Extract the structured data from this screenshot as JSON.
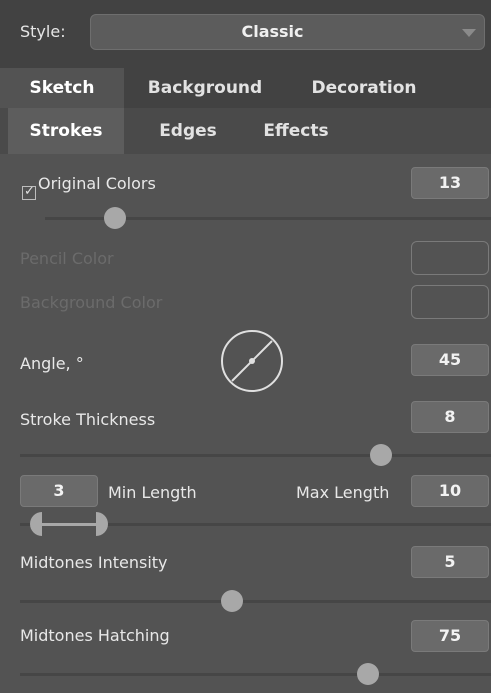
{
  "style": {
    "label": "Style:",
    "selected": "Classic"
  },
  "main_tabs": [
    {
      "label": "Sketch",
      "active": true
    },
    {
      "label": "Background",
      "active": false
    },
    {
      "label": "Decoration",
      "active": false
    }
  ],
  "sub_tabs": [
    {
      "label": "Strokes",
      "active": true
    },
    {
      "label": "Edges",
      "active": false
    },
    {
      "label": "Effects",
      "active": false
    }
  ],
  "original_colors": {
    "label": "Original Colors",
    "checked": true,
    "value": "13",
    "slider_fraction": 0.21
  },
  "pencil_color": {
    "label": "Pencil Color",
    "enabled": false
  },
  "background_color": {
    "label": "Background Color",
    "enabled": false
  },
  "angle": {
    "label": "Angle, °",
    "value": "45"
  },
  "stroke_thickness": {
    "label": "Stroke Thickness",
    "value": "8",
    "slider_fraction": 0.8
  },
  "length": {
    "min_value": "3",
    "min_label": "Min Length",
    "max_label": "Max Length",
    "max_value": "10"
  },
  "midtones_intensity": {
    "label": "Midtones Intensity",
    "value": "5",
    "slider_fraction": 0.45
  },
  "midtones_hatching": {
    "label": "Midtones Hatching",
    "value": "75",
    "slider_fraction": 0.75
  },
  "colors": {
    "panel": "#535353",
    "header": "#424242",
    "handle": "#a8a8a8"
  },
  "icons": {
    "dropdown": "chevron-down-icon",
    "angle": "angle-dial-icon",
    "check": "checkmark-icon"
  }
}
